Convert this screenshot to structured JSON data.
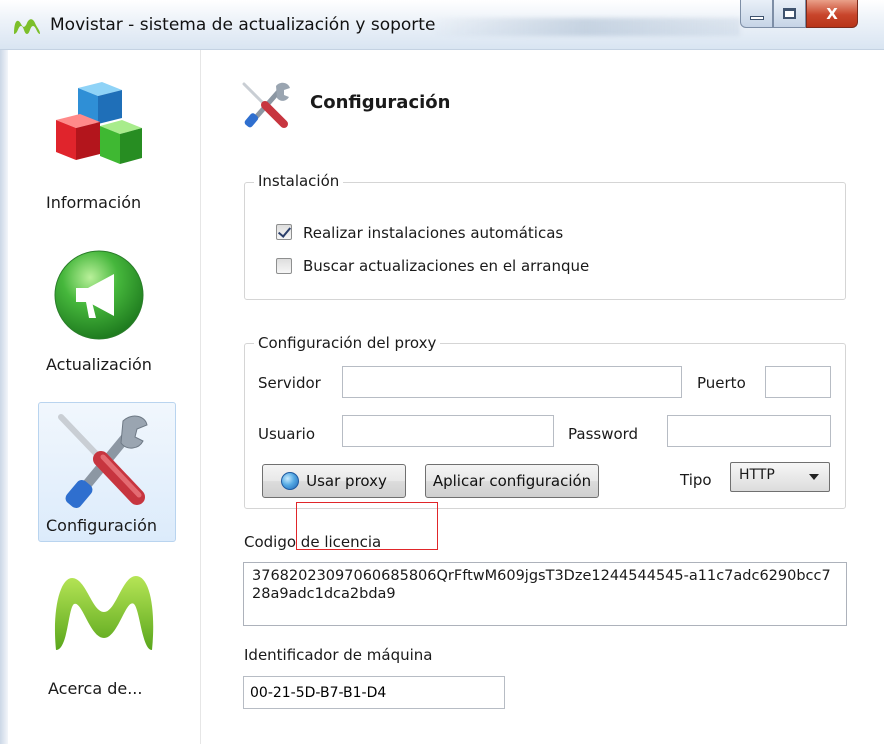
{
  "window": {
    "title": "Movistar - sistema de actualización y soporte",
    "buttons": {
      "minimize": "minimize",
      "maximize": "maximize",
      "close": "X"
    }
  },
  "sidebar": {
    "items": [
      {
        "label": "Información",
        "icon": "cubes-icon",
        "selected": false
      },
      {
        "label": "Actualización",
        "icon": "megaphone-icon",
        "selected": false
      },
      {
        "label": "Configuración",
        "icon": "tools-icon",
        "selected": true
      },
      {
        "label": "Acerca de...",
        "icon": "movistar-logo-icon",
        "selected": false
      }
    ]
  },
  "header": {
    "title": "Configuración",
    "icon": "tools-icon"
  },
  "instalacion": {
    "title": "Instalación",
    "auto_install": {
      "label": "Realizar instalaciones automáticas",
      "checked": true
    },
    "check_updates": {
      "label": "Buscar actualizaciones en el arranque",
      "checked": false
    }
  },
  "proxy": {
    "title": "Configuración del proxy",
    "server_label": "Servidor",
    "server_value": "",
    "port_label": "Puerto",
    "port_value": "",
    "user_label": "Usuario",
    "user_value": "",
    "password_label": "Password",
    "password_value": "",
    "use_proxy_label": "Usar proxy",
    "apply_label": "Aplicar configuración",
    "type_label": "Tipo",
    "type_value": "HTTP"
  },
  "license": {
    "label": "Codigo de licencia",
    "value": "37682023097060685806QrFftwM609jgsT3Dze1244544545-a11c7adc6290bcc728a9adc1dca2bda9"
  },
  "machine": {
    "label": "Identificador de máquina",
    "value": "00-21-5D-B7-B1-D4"
  },
  "colors": {
    "selected_bg": "#dcebfb",
    "close_button": "#c8452b",
    "highlight_box": "#e0262a"
  }
}
